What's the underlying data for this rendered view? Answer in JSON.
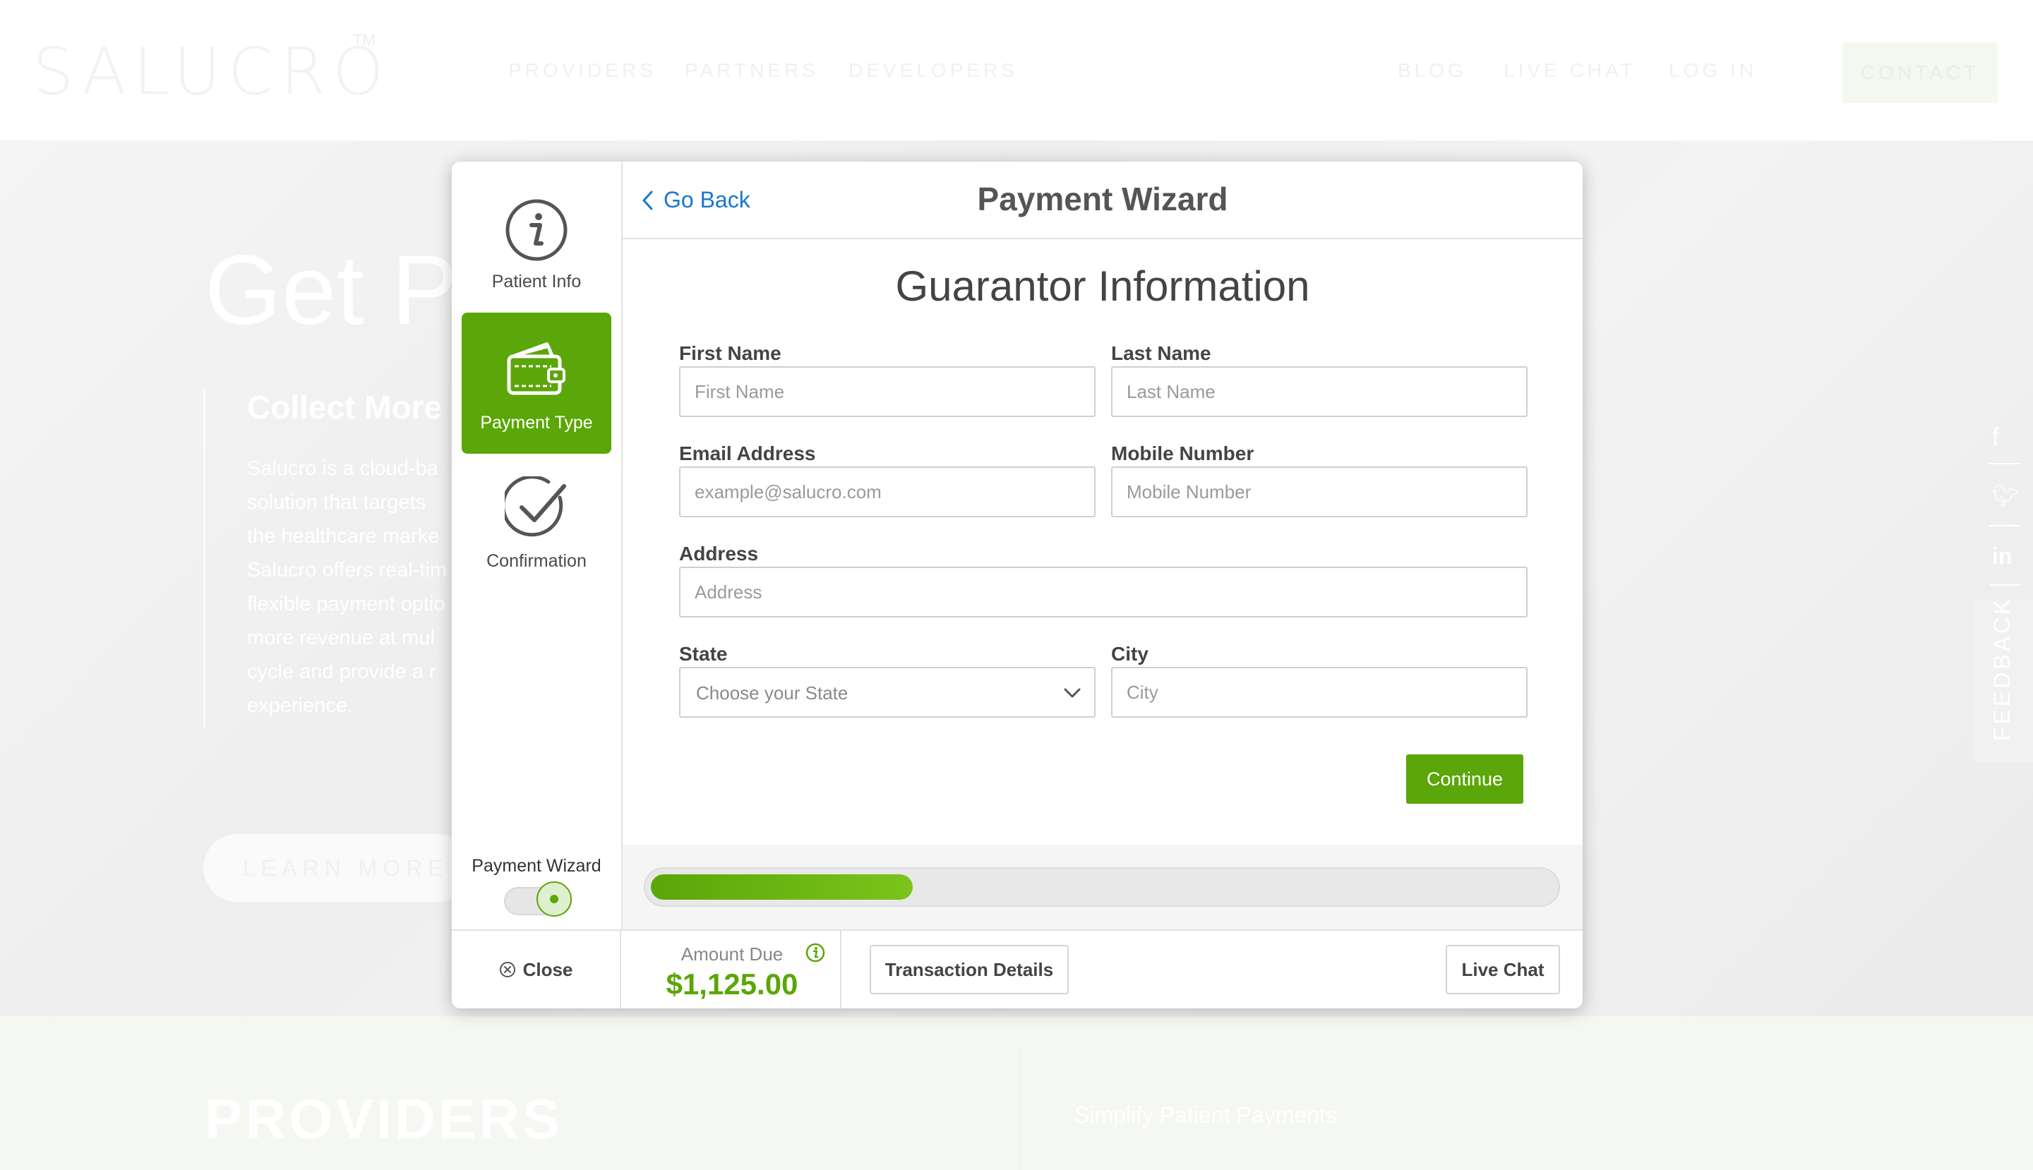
{
  "site": {
    "logo": "SALUCRO",
    "logo_tm": "TM",
    "nav_left": [
      "PROVIDERS",
      "PARTNERS",
      "DEVELOPERS"
    ],
    "nav_right": [
      "BLOG",
      "LIVE CHAT",
      "LOG IN"
    ],
    "contact": "CONTACT",
    "hero_title": "Get Pa",
    "hero_subtitle": "Collect More",
    "hero_paragraph": "Salucro is a cloud-ba solution that targets the healthcare marke Salucro offers real-tim flexible payment optio more revenue at mul cycle and provide a r experience.",
    "learn_more": "LEARN MORE",
    "feedback": "FEEDBACK",
    "section_title": "PROVIDERS",
    "section_right": "Simplify Patient Payments"
  },
  "wizard": {
    "title": "Payment Wizard",
    "go_back": "Go Back",
    "steps": [
      {
        "label": "Patient Info",
        "icon": "info-icon"
      },
      {
        "label": "Payment Type",
        "icon": "wallet-icon",
        "active": true
      },
      {
        "label": "Confirmation",
        "icon": "checkmark-icon"
      }
    ],
    "mode_label": "Payment Wizard",
    "toggle_on": true
  },
  "form": {
    "section_title": "Guarantor Information",
    "first_name": {
      "label": "First Name",
      "placeholder": "First Name",
      "value": ""
    },
    "last_name": {
      "label": "Last Name",
      "placeholder": "Last Name",
      "value": ""
    },
    "email": {
      "label": "Email Address",
      "placeholder": "example@salucro.com",
      "value": ""
    },
    "mobile": {
      "label": "Mobile Number",
      "placeholder": "Mobile Number",
      "value": ""
    },
    "address": {
      "label": "Address",
      "placeholder": "Address",
      "value": ""
    },
    "state": {
      "label": "State",
      "selected": "Choose your State"
    },
    "city": {
      "label": "City",
      "placeholder": "City",
      "value": ""
    },
    "continue": "Continue"
  },
  "progress": {
    "fraction": 0.29
  },
  "footer": {
    "close": "Close",
    "amount_label": "Amount Due",
    "amount_value": "$1,125.00",
    "transaction_details": "Transaction Details",
    "live_chat": "Live Chat"
  },
  "colors": {
    "accent": "#5ba608",
    "link": "#1976d2"
  }
}
